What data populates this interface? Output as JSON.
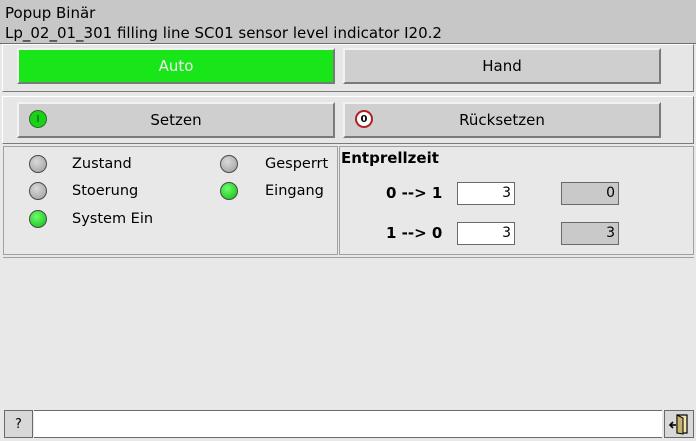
{
  "header": {
    "title": "Popup Binär",
    "subtitle": "Lp_02_01_301 filling line SC01 sensor level indicator I20.2"
  },
  "mode": {
    "auto_label": "Auto",
    "hand_label": "Hand",
    "active": "auto",
    "active_color": "#19e619"
  },
  "actions": {
    "set_label": "Setzen",
    "set_icon_text": "I",
    "reset_label": "Rücksetzen",
    "reset_icon_text": "0"
  },
  "status": {
    "items": [
      {
        "label": "Zustand",
        "state": "off"
      },
      {
        "label": "Stoerung",
        "state": "off"
      },
      {
        "label": "System Ein",
        "state": "on"
      },
      {
        "label": "Gesperrt",
        "state": "off"
      },
      {
        "label": "Eingang",
        "state": "on"
      }
    ],
    "led_on_color": "#19e619",
    "led_off_color": "#a6a6a6"
  },
  "debounce": {
    "title": "Entprellzeit",
    "rows": [
      {
        "transition": "0 --> 1",
        "setpoint": "3",
        "actual": "0"
      },
      {
        "transition": "1 --> 0",
        "setpoint": "3",
        "actual": "3"
      }
    ]
  },
  "footer": {
    "help_label": "?",
    "status_text": "",
    "exit_icon": "exit-door-icon"
  }
}
